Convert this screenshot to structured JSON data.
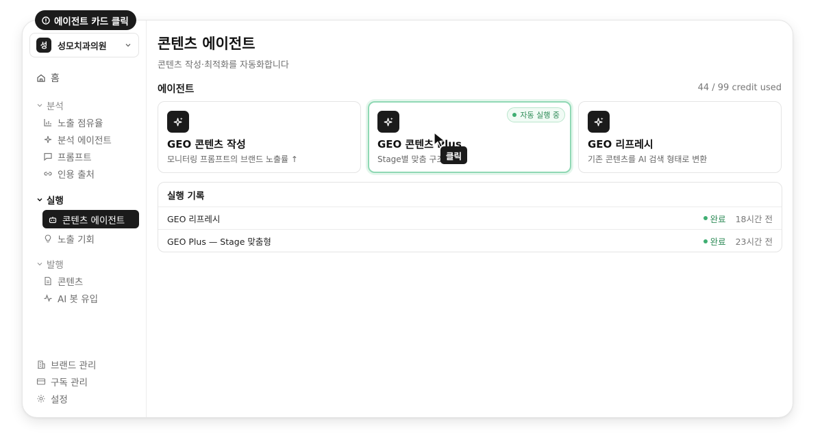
{
  "overlay": {
    "step_label": "에이전트 카드 클릭",
    "click_label": "클릭"
  },
  "sidebar": {
    "org_avatar": "성",
    "org_name": "성모치과의원",
    "home": "홈",
    "sections": {
      "analysis": "분석",
      "execution": "실행",
      "publish": "발행"
    },
    "analysis_items": [
      "노출 점유율",
      "분석 에이전트",
      "프롬프트",
      "인용 출처"
    ],
    "execution_items": [
      "콘텐츠 에이전트",
      "노출 기회"
    ],
    "publish_items": [
      "콘텐츠",
      "AI 봇 유입"
    ],
    "bottom_items": [
      "브랜드 관리",
      "구독 관리",
      "설정"
    ]
  },
  "main": {
    "title": "콘텐츠 에이전트",
    "subtitle": "콘텐츠 작성·최적화를 자동화합니다",
    "agents_heading": "에이전트",
    "credits": "44 / 99 credit used",
    "cards": [
      {
        "title": "GEO 콘텐츠 작성",
        "desc": "모니터링 프롬프트의 브랜드 노출률 ↑"
      },
      {
        "title": "GEO 콘텐츠 Plus",
        "desc": "Stage별 맞춤 구조",
        "badge": "자동 실행 중"
      },
      {
        "title": "GEO 리프레시",
        "desc": "기존 콘텐츠를 AI 검색 형태로 변환"
      }
    ],
    "history": {
      "heading": "실행 기록",
      "rows": [
        {
          "name": "GEO 리프레시",
          "status": "완료",
          "time": "18시간 전"
        },
        {
          "name": "GEO Plus — Stage 맞춤형",
          "status": "완료",
          "time": "23시간 전"
        }
      ]
    }
  },
  "colors": {
    "accent_dark": "#1b1b1b",
    "success": "#2e8b57",
    "running_border": "#8fd8b4"
  }
}
